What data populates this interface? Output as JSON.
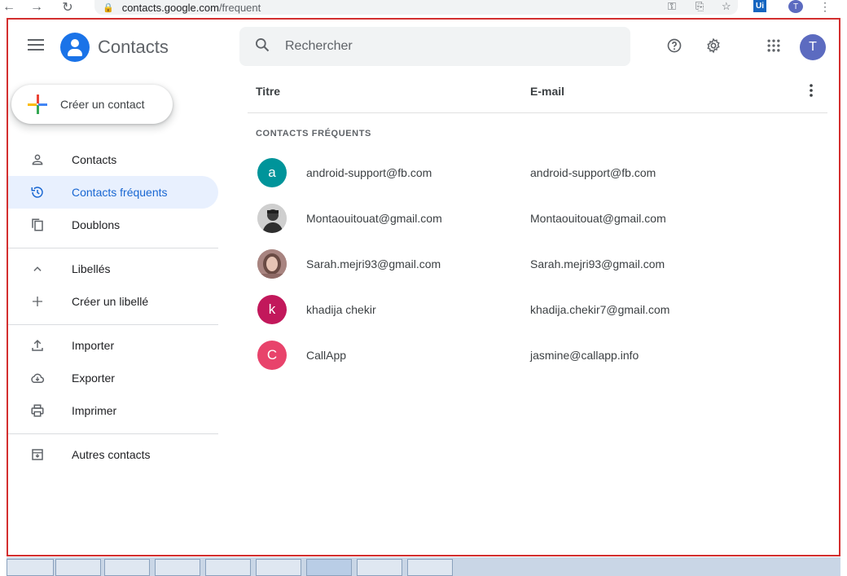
{
  "browser": {
    "url_host": "contacts.google.com",
    "url_path": "/frequent",
    "ui_badge": "Ui",
    "profile_initial": "T"
  },
  "header": {
    "app_title": "Contacts",
    "search_placeholder": "Rechercher",
    "user_initial": "T"
  },
  "sidebar": {
    "create_label": "Créer un contact",
    "items": [
      {
        "label": "Contacts",
        "icon": "person-icon"
      },
      {
        "label": "Contacts fréquents",
        "icon": "history-icon",
        "active": true
      },
      {
        "label": "Doublons",
        "icon": "copy-icon"
      }
    ],
    "labels_section": {
      "label": "Libellés",
      "icon": "chevron-up-icon"
    },
    "create_label_item": {
      "label": "Créer un libellé",
      "icon": "plus-icon"
    },
    "actions": [
      {
        "label": "Importer",
        "icon": "upload-icon"
      },
      {
        "label": "Exporter",
        "icon": "cloud-download-icon"
      },
      {
        "label": "Imprimer",
        "icon": "print-icon"
      }
    ],
    "other_contacts": {
      "label": "Autres contacts",
      "icon": "archive-icon"
    }
  },
  "list": {
    "col_title": "Titre",
    "col_email": "E-mail",
    "section": "CONTACTS FRÉQUENTS",
    "rows": [
      {
        "initial": "a",
        "avatar_color": "#00949a",
        "name": "android-support@fb.com",
        "email": "android-support@fb.com"
      },
      {
        "initial": "",
        "avatar_color": "#4e4e4e",
        "name": "Montaouitouat@gmail.com",
        "email": "Montaouitouat@gmail.com"
      },
      {
        "initial": "",
        "avatar_color": "#b08a86",
        "name": "Sarah.mejri93@gmail.com",
        "email": "Sarah.mejri93@gmail.com"
      },
      {
        "initial": "k",
        "avatar_color": "#c2185b",
        "name": "khadija chekir",
        "email": "khadija.chekir7@gmail.com"
      },
      {
        "initial": "C",
        "avatar_color": "#e8436b",
        "name": "CallApp",
        "email": "jasmine@callapp.info"
      }
    ]
  },
  "colors": {
    "accent": "#1a73e8",
    "active_bg": "#e8f0fe",
    "highlight_border": "#d32f2f"
  }
}
